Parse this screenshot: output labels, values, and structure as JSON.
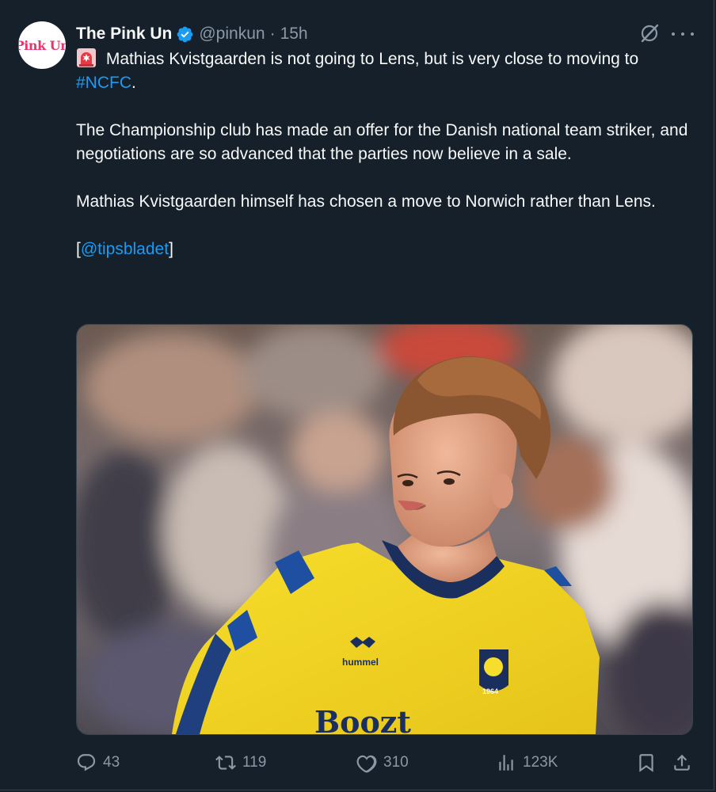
{
  "author": {
    "avatar_text": "Pink Un",
    "display_name": "The Pink Un",
    "handle": "@pinkun",
    "separator": "·",
    "time": "15h",
    "verified": true
  },
  "tweet": {
    "siren_emoji": "rotating-light-icon",
    "line1_text": " Mathias Kvistgaarden is not going to Lens, but is very close to moving to ",
    "hashtag": "#NCFC",
    "line1_end": ".",
    "paragraph2": "The Championship club has made an offer for the Danish national team striker, and negotiations are so advanced that the parties now believe in a sale.",
    "paragraph3": "Mathias Kvistgaarden himself has chosen a move to Norwich rather than Lens.",
    "source_open": "[",
    "source_mention": "@tipsbladet",
    "source_close": "]"
  },
  "media": {
    "description_icon": "photo-footballer",
    "shirt_sponsor": "Boozt",
    "shirt_brand": "hummel",
    "badge_year": "1964"
  },
  "actions": {
    "reply_count": "43",
    "retweet_count": "119",
    "like_count": "310",
    "views_count": "123K"
  },
  "colors": {
    "background": "#15202b",
    "text": "#f7f9f9",
    "muted": "#8b98a5",
    "accent": "#1d9bf0",
    "brand_pink": "#e8356d"
  }
}
